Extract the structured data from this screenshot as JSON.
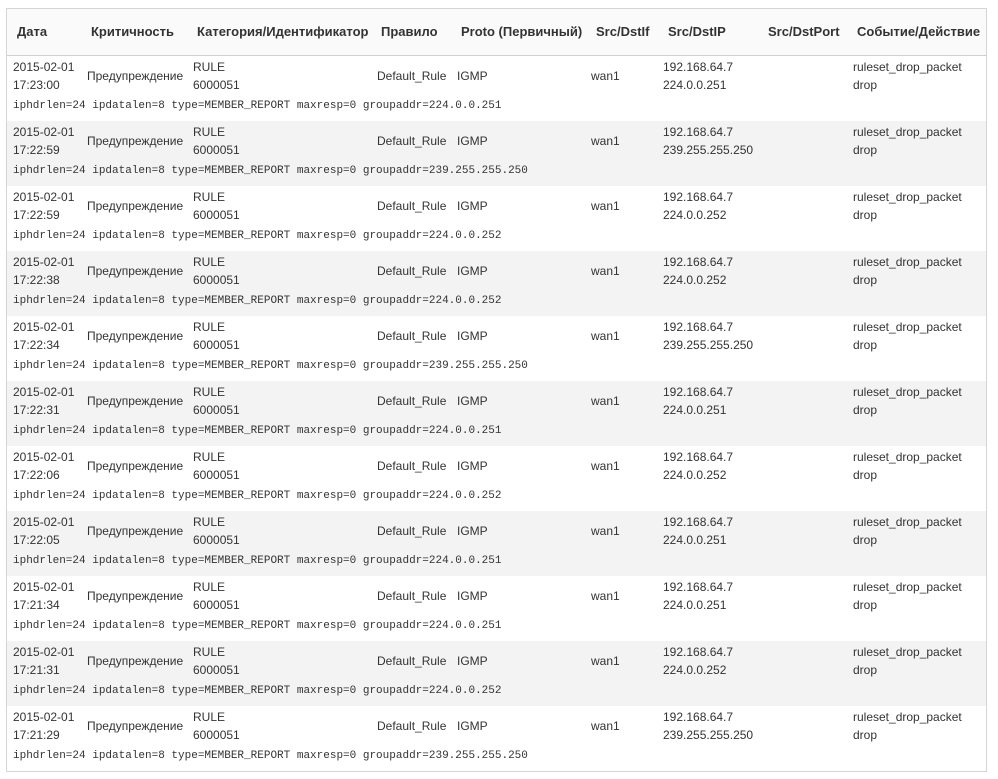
{
  "columns": [
    "Дата",
    "Критичность",
    "Категория/Идентификатор",
    "Правило",
    "Proto (Первичный)",
    "Src/DstIf",
    "Src/DstIP",
    "Src/DstPort",
    "Событие/Действие"
  ],
  "rows": [
    {
      "date": "2015-02-01",
      "time": "17:23:00",
      "severity": "Предупреждение",
      "category": "RULE",
      "id": "6000051",
      "rule": "Default_Rule",
      "proto": "IGMP",
      "iface": "wan1",
      "src_ip": "192.168.64.7",
      "dst_ip": "224.0.0.251",
      "event": "ruleset_drop_packet",
      "action": "drop",
      "detail": "iphdrlen=24 ipdatalen=8 type=MEMBER_REPORT maxresp=0 groupaddr=224.0.0.251"
    },
    {
      "date": "2015-02-01",
      "time": "17:22:59",
      "severity": "Предупреждение",
      "category": "RULE",
      "id": "6000051",
      "rule": "Default_Rule",
      "proto": "IGMP",
      "iface": "wan1",
      "src_ip": "192.168.64.7",
      "dst_ip": "239.255.255.250",
      "event": "ruleset_drop_packet",
      "action": "drop",
      "detail": "iphdrlen=24 ipdatalen=8 type=MEMBER_REPORT maxresp=0 groupaddr=239.255.255.250"
    },
    {
      "date": "2015-02-01",
      "time": "17:22:59",
      "severity": "Предупреждение",
      "category": "RULE",
      "id": "6000051",
      "rule": "Default_Rule",
      "proto": "IGMP",
      "iface": "wan1",
      "src_ip": "192.168.64.7",
      "dst_ip": "224.0.0.252",
      "event": "ruleset_drop_packet",
      "action": "drop",
      "detail": "iphdrlen=24 ipdatalen=8 type=MEMBER_REPORT maxresp=0 groupaddr=224.0.0.252"
    },
    {
      "date": "2015-02-01",
      "time": "17:22:38",
      "severity": "Предупреждение",
      "category": "RULE",
      "id": "6000051",
      "rule": "Default_Rule",
      "proto": "IGMP",
      "iface": "wan1",
      "src_ip": "192.168.64.7",
      "dst_ip": "224.0.0.252",
      "event": "ruleset_drop_packet",
      "action": "drop",
      "detail": "iphdrlen=24 ipdatalen=8 type=MEMBER_REPORT maxresp=0 groupaddr=224.0.0.252"
    },
    {
      "date": "2015-02-01",
      "time": "17:22:34",
      "severity": "Предупреждение",
      "category": "RULE",
      "id": "6000051",
      "rule": "Default_Rule",
      "proto": "IGMP",
      "iface": "wan1",
      "src_ip": "192.168.64.7",
      "dst_ip": "239.255.255.250",
      "event": "ruleset_drop_packet",
      "action": "drop",
      "detail": "iphdrlen=24 ipdatalen=8 type=MEMBER_REPORT maxresp=0 groupaddr=239.255.255.250"
    },
    {
      "date": "2015-02-01",
      "time": "17:22:31",
      "severity": "Предупреждение",
      "category": "RULE",
      "id": "6000051",
      "rule": "Default_Rule",
      "proto": "IGMP",
      "iface": "wan1",
      "src_ip": "192.168.64.7",
      "dst_ip": "224.0.0.251",
      "event": "ruleset_drop_packet",
      "action": "drop",
      "detail": "iphdrlen=24 ipdatalen=8 type=MEMBER_REPORT maxresp=0 groupaddr=224.0.0.251"
    },
    {
      "date": "2015-02-01",
      "time": "17:22:06",
      "severity": "Предупреждение",
      "category": "RULE",
      "id": "6000051",
      "rule": "Default_Rule",
      "proto": "IGMP",
      "iface": "wan1",
      "src_ip": "192.168.64.7",
      "dst_ip": "224.0.0.252",
      "event": "ruleset_drop_packet",
      "action": "drop",
      "detail": "iphdrlen=24 ipdatalen=8 type=MEMBER_REPORT maxresp=0 groupaddr=224.0.0.252"
    },
    {
      "date": "2015-02-01",
      "time": "17:22:05",
      "severity": "Предупреждение",
      "category": "RULE",
      "id": "6000051",
      "rule": "Default_Rule",
      "proto": "IGMP",
      "iface": "wan1",
      "src_ip": "192.168.64.7",
      "dst_ip": "224.0.0.251",
      "event": "ruleset_drop_packet",
      "action": "drop",
      "detail": "iphdrlen=24 ipdatalen=8 type=MEMBER_REPORT maxresp=0 groupaddr=224.0.0.251"
    },
    {
      "date": "2015-02-01",
      "time": "17:21:34",
      "severity": "Предупреждение",
      "category": "RULE",
      "id": "6000051",
      "rule": "Default_Rule",
      "proto": "IGMP",
      "iface": "wan1",
      "src_ip": "192.168.64.7",
      "dst_ip": "224.0.0.251",
      "event": "ruleset_drop_packet",
      "action": "drop",
      "detail": "iphdrlen=24 ipdatalen=8 type=MEMBER_REPORT maxresp=0 groupaddr=224.0.0.251"
    },
    {
      "date": "2015-02-01",
      "time": "17:21:31",
      "severity": "Предупреждение",
      "category": "RULE",
      "id": "6000051",
      "rule": "Default_Rule",
      "proto": "IGMP",
      "iface": "wan1",
      "src_ip": "192.168.64.7",
      "dst_ip": "224.0.0.252",
      "event": "ruleset_drop_packet",
      "action": "drop",
      "detail": "iphdrlen=24 ipdatalen=8 type=MEMBER_REPORT maxresp=0 groupaddr=224.0.0.252"
    },
    {
      "date": "2015-02-01",
      "time": "17:21:29",
      "severity": "Предупреждение",
      "category": "RULE",
      "id": "6000051",
      "rule": "Default_Rule",
      "proto": "IGMP",
      "iface": "wan1",
      "src_ip": "192.168.64.7",
      "dst_ip": "239.255.255.250",
      "event": "ruleset_drop_packet",
      "action": "drop",
      "detail": "iphdrlen=24 ipdatalen=8 type=MEMBER_REPORT maxresp=0 groupaddr=239.255.255.250"
    }
  ]
}
